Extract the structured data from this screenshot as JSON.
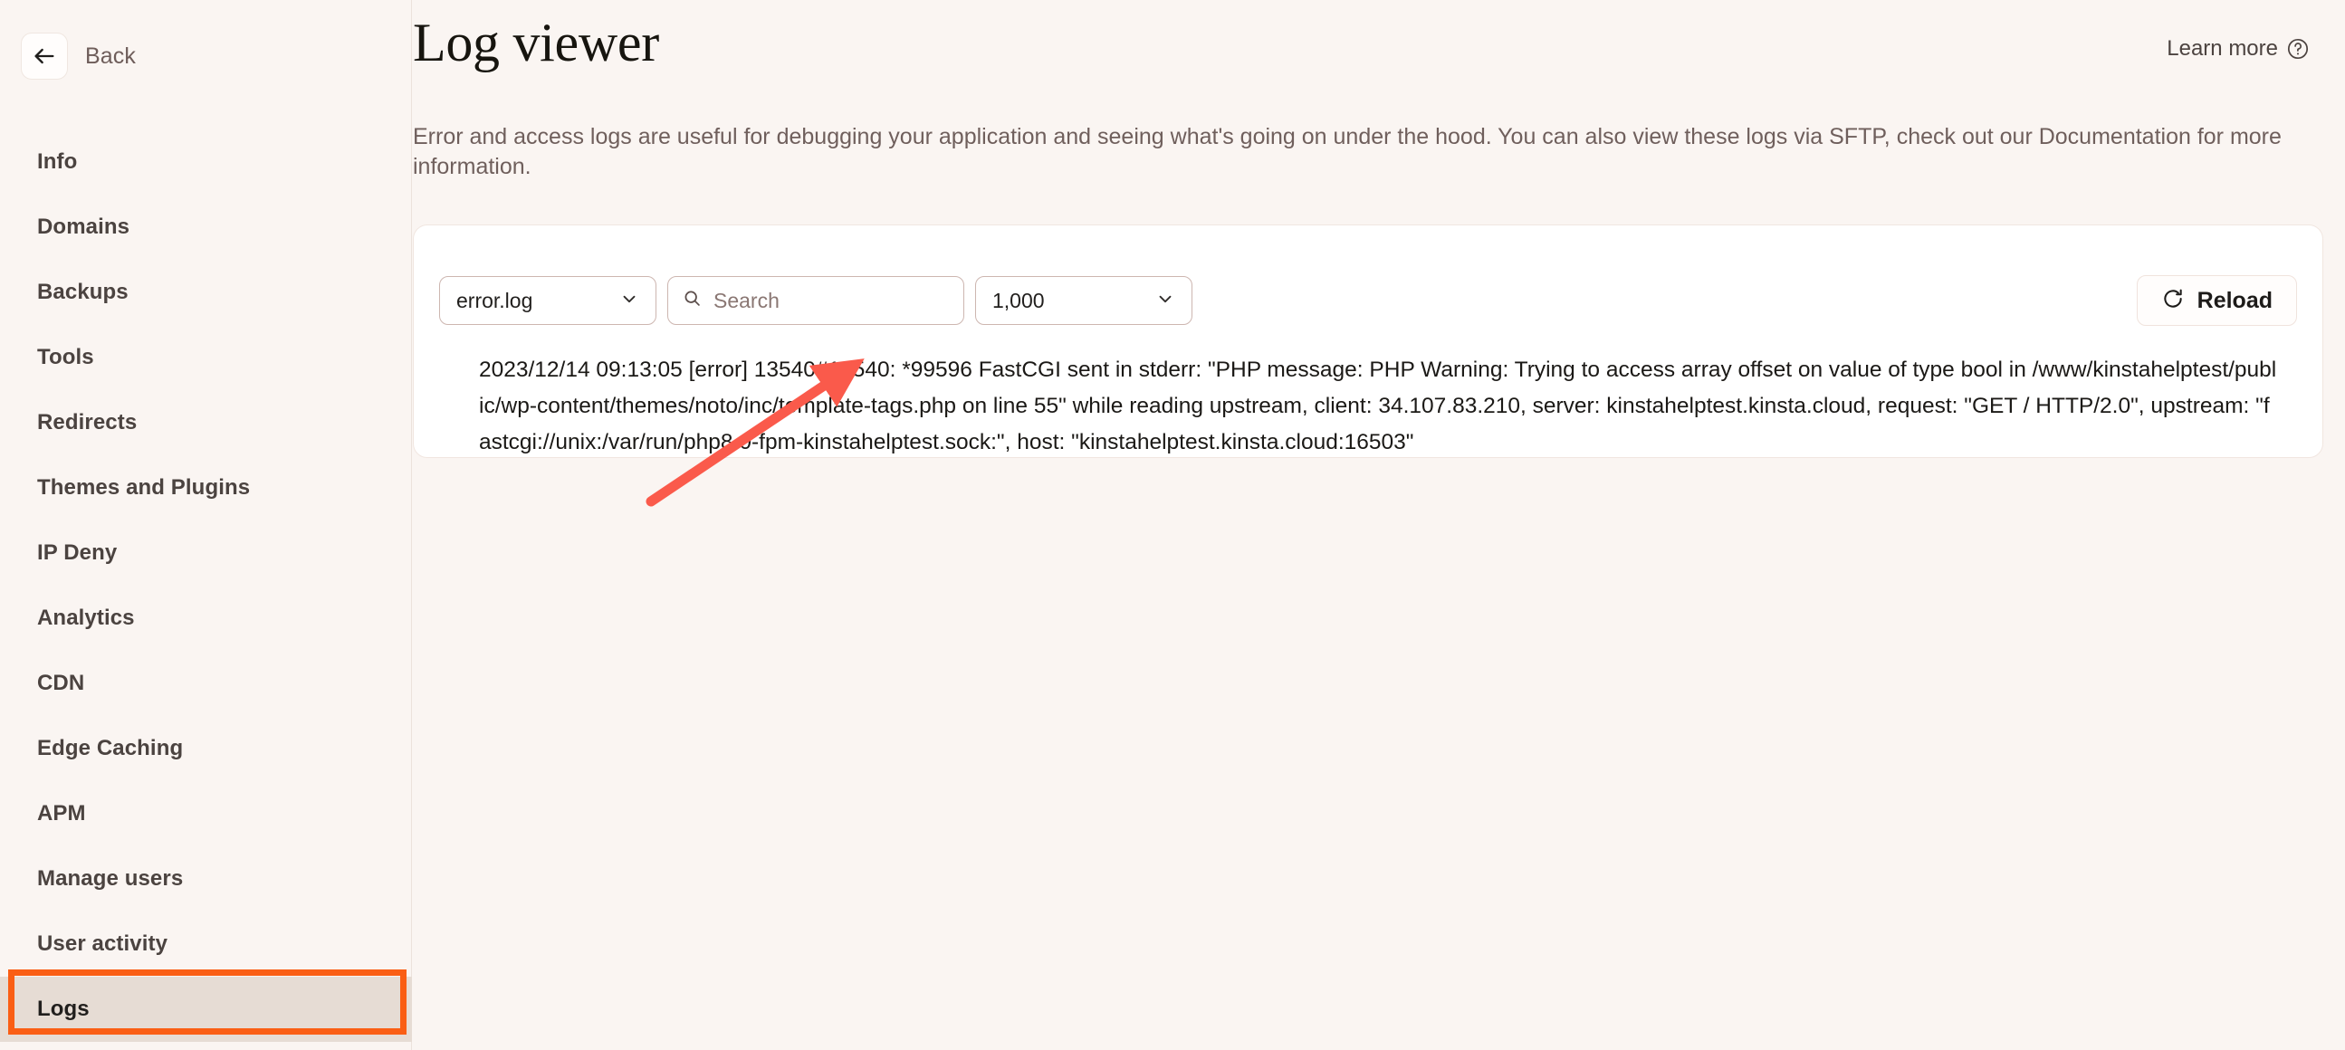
{
  "sidebar": {
    "back_label": "Back",
    "back_icon": "arrow-left-icon",
    "items": [
      {
        "label": "Info",
        "active": false
      },
      {
        "label": "Domains",
        "active": false
      },
      {
        "label": "Backups",
        "active": false
      },
      {
        "label": "Tools",
        "active": false
      },
      {
        "label": "Redirects",
        "active": false
      },
      {
        "label": "Themes and Plugins",
        "active": false
      },
      {
        "label": "IP Deny",
        "active": false
      },
      {
        "label": "Analytics",
        "active": false
      },
      {
        "label": "CDN",
        "active": false
      },
      {
        "label": "Edge Caching",
        "active": false
      },
      {
        "label": "APM",
        "active": false
      },
      {
        "label": "Manage users",
        "active": false
      },
      {
        "label": "User activity",
        "active": false
      },
      {
        "label": "Logs",
        "active": true
      }
    ]
  },
  "header": {
    "title": "Log viewer",
    "learn_more_label": "Learn more",
    "learn_more_icon": "question-circle-icon"
  },
  "description": {
    "text": "Error and access logs are useful for debugging your application and seeing what's going on under the hood. You can also view these logs via SFTP, check out our Documentation for more information."
  },
  "controls": {
    "file_select_value": "error.log",
    "file_select_icon": "chevron-down-icon",
    "search_placeholder": "Search",
    "search_value": "",
    "search_icon": "search-icon",
    "lines_select_value": "1,000",
    "lines_select_icon": "chevron-down-icon",
    "reload_label": "Reload",
    "reload_icon": "refresh-icon"
  },
  "log": {
    "entry": "2023/12/14 09:13:05 [error] 13540#13540: *99596 FastCGI sent in stderr: \"PHP message: PHP Warning: Trying to access array offset on value of type bool in /www/kinstahelptest/public/wp-content/themes/noto/inc/template-tags.php on line 55\" while reading upstream, client: 34.107.83.210, server: kinstahelptest.kinsta.cloud, request: \"GET / HTTP/2.0\", upstream: \"fastcgi://unix:/var/run/php8.0-fpm-kinstahelptest.sock:\", host: \"kinstahelptest.kinsta.cloud:16503\""
  },
  "annotations": {
    "arrow_color": "#fa5a4b",
    "highlight_border_color": "#fa5e14",
    "highlight_fill_color": "#e6dcd4"
  }
}
